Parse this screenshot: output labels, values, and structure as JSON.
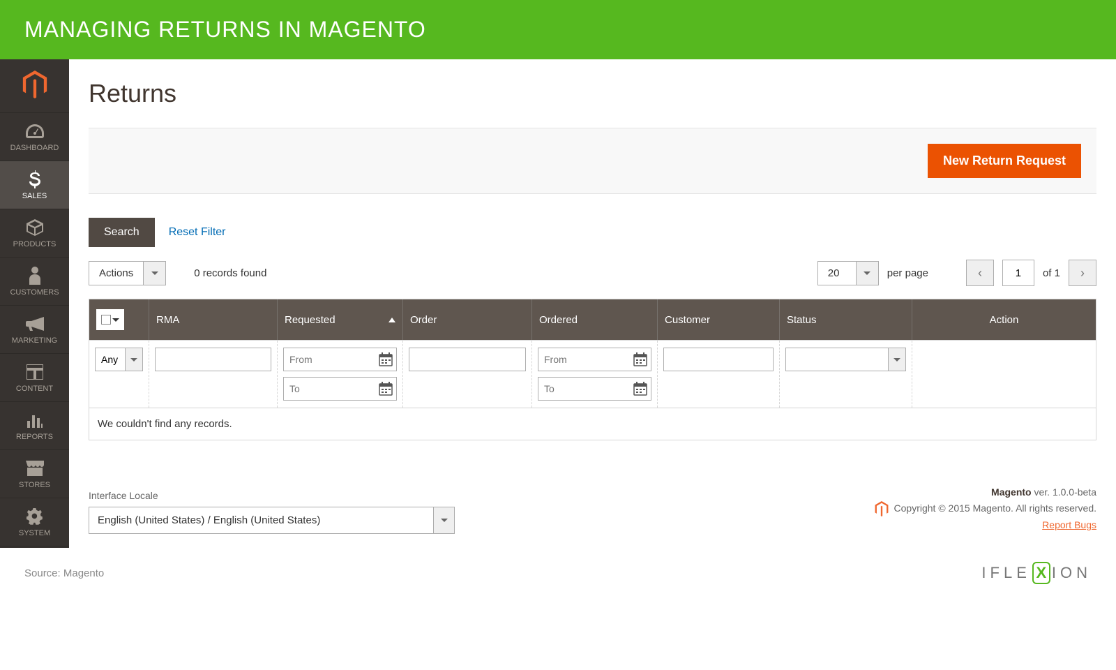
{
  "banner": {
    "title": "MANAGING RETURNS IN MAGENTO"
  },
  "sidebar": {
    "items": [
      {
        "label": "DASHBOARD"
      },
      {
        "label": "SALES"
      },
      {
        "label": "PRODUCTS"
      },
      {
        "label": "CUSTOMERS"
      },
      {
        "label": "MARKETING"
      },
      {
        "label": "CONTENT"
      },
      {
        "label": "REPORTS"
      },
      {
        "label": "STORES"
      },
      {
        "label": "SYSTEM"
      }
    ]
  },
  "page": {
    "title": "Returns"
  },
  "actions": {
    "new_return": "New Return Request"
  },
  "toolbar": {
    "search": "Search",
    "reset": "Reset Filter",
    "actions_label": "Actions",
    "records_found": "0 records found",
    "per_page_value": "20",
    "per_page_label": "per page",
    "page_value": "1",
    "page_total": "of 1"
  },
  "grid": {
    "headers": {
      "rma": "RMA",
      "requested": "Requested",
      "order": "Order",
      "ordered": "Ordered",
      "customer": "Customer",
      "status": "Status",
      "action": "Action"
    },
    "filters": {
      "any": "Any",
      "from": "From",
      "to": "To"
    },
    "empty": "We couldn't find any records."
  },
  "footer": {
    "locale_label": "Interface Locale",
    "locale_value": "English (United States) / English (United States)",
    "version_brand": "Magento",
    "version_suffix": " ver. 1.0.0-beta",
    "copyright": "Copyright © 2015 Magento. All rights reserved.",
    "report_bugs": "Report Bugs"
  },
  "source": {
    "text": "Source: Magento",
    "iflexion_pre": "IFLE",
    "iflexion_x": "X",
    "iflexion_post": "ION"
  }
}
